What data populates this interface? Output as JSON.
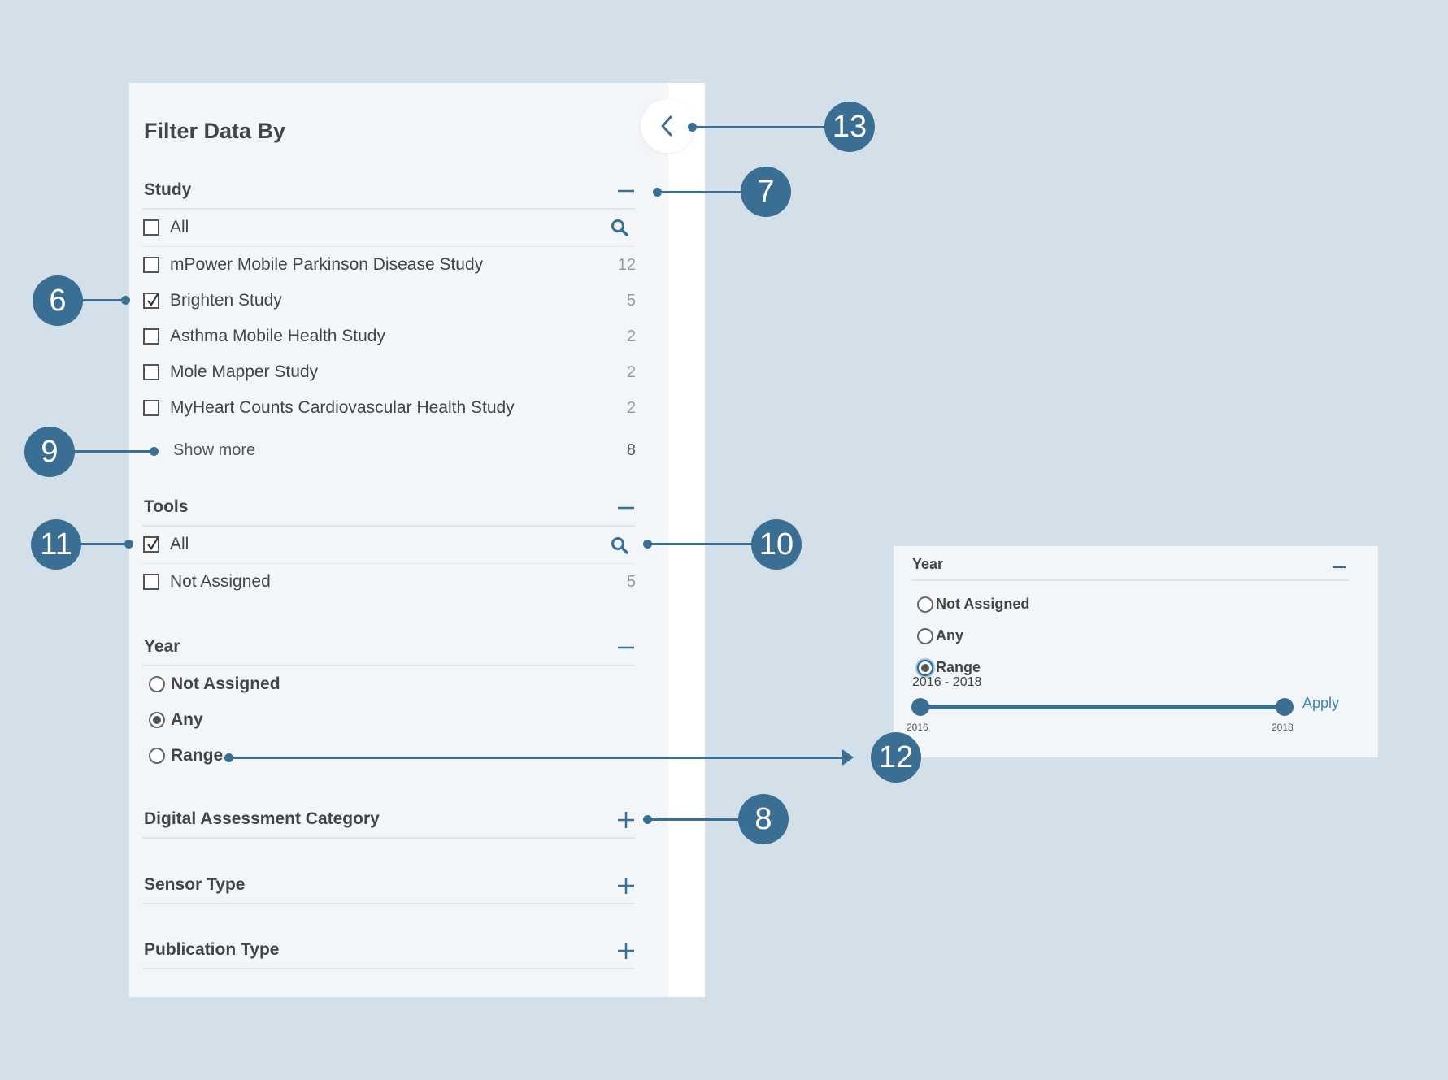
{
  "panel": {
    "title": "Filter Data By",
    "collapse_icon": "chevron-left-icon"
  },
  "study": {
    "title": "Study",
    "toggle": "minus",
    "all": {
      "label": "All",
      "checked": false
    },
    "items": [
      {
        "label": "mPower Mobile Parkinson Disease Study",
        "count": "12",
        "checked": false
      },
      {
        "label": "Brighten Study",
        "count": "5",
        "checked": true
      },
      {
        "label": "Asthma Mobile Health Study",
        "count": "2",
        "checked": false
      },
      {
        "label": "Mole Mapper Study",
        "count": "2",
        "checked": false
      },
      {
        "label": "MyHeart Counts Cardiovascular Health Study",
        "count": "2",
        "checked": false
      }
    ],
    "show_more": {
      "label": "Show more",
      "count": "8"
    }
  },
  "tools": {
    "title": "Tools",
    "toggle": "minus",
    "all": {
      "label": "All",
      "checked": true
    },
    "items": [
      {
        "label": "Not Assigned",
        "count": "5",
        "checked": false
      }
    ]
  },
  "year": {
    "title": "Year",
    "toggle": "minus",
    "options": [
      {
        "label": "Not Assigned",
        "selected": false
      },
      {
        "label": "Any",
        "selected": true
      },
      {
        "label": "Range",
        "selected": false
      }
    ]
  },
  "collapsed_sections": [
    {
      "title": "Digital Assessment Category",
      "toggle": "plus"
    },
    {
      "title": "Sensor Type",
      "toggle": "plus"
    },
    {
      "title": "Publication Type",
      "toggle": "plus"
    }
  ],
  "inset_year": {
    "title": "Year",
    "options": [
      {
        "label": "Not Assigned",
        "selected": false
      },
      {
        "label": "Any",
        "selected": false
      },
      {
        "label": "Range",
        "selected": true
      }
    ],
    "range_text": "2016 - 2018",
    "slider_min": "2016",
    "slider_max": "2018",
    "apply_label": "Apply"
  },
  "callouts": [
    "13",
    "7",
    "6",
    "9",
    "11",
    "10",
    "12",
    "8"
  ],
  "colors": {
    "background": "#d3e0e9",
    "panel": "#f3f6f8",
    "accent": "#3a6e93",
    "link": "#3a84b8"
  }
}
